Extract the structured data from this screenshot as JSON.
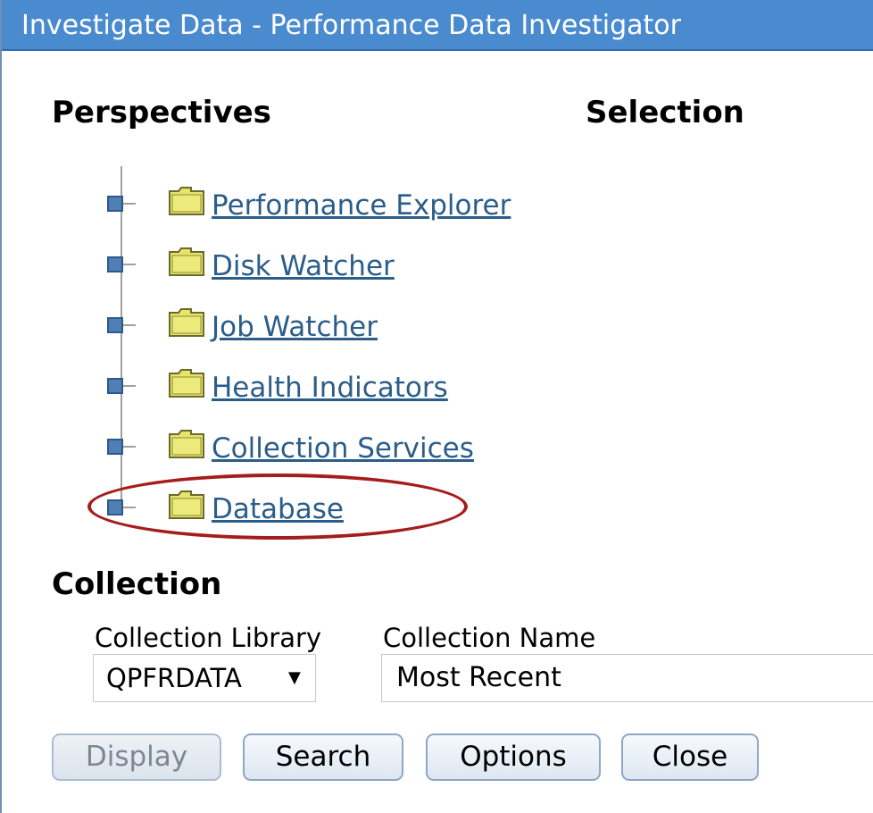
{
  "window": {
    "title": "Investigate Data - Performance Data Investigator"
  },
  "headings": {
    "perspectives": "Perspectives",
    "selection": "Selection",
    "collection": "Collection"
  },
  "tree": {
    "items": [
      {
        "label": "Performance Explorer",
        "icon": "folder-icon"
      },
      {
        "label": "Disk Watcher",
        "icon": "folder-icon"
      },
      {
        "label": "Job Watcher",
        "icon": "folder-icon"
      },
      {
        "label": "Health Indicators",
        "icon": "folder-icon"
      },
      {
        "label": "Collection Services",
        "icon": "folder-icon"
      },
      {
        "label": "Database",
        "icon": "folder-icon",
        "highlighted": true
      }
    ]
  },
  "collection": {
    "library_label": "Collection Library",
    "library_value": "QPFRDATA",
    "name_label": "Collection Name",
    "name_value": "Most Recent"
  },
  "buttons": {
    "display": "Display",
    "search": "Search",
    "options": "Options",
    "close": "Close"
  },
  "colors": {
    "titlebar": "#4a8bd0",
    "link": "#2b5d8a",
    "highlight_oval": "#a51c1c",
    "expander": "#4f7fb5",
    "folder": "#e6e46a"
  }
}
